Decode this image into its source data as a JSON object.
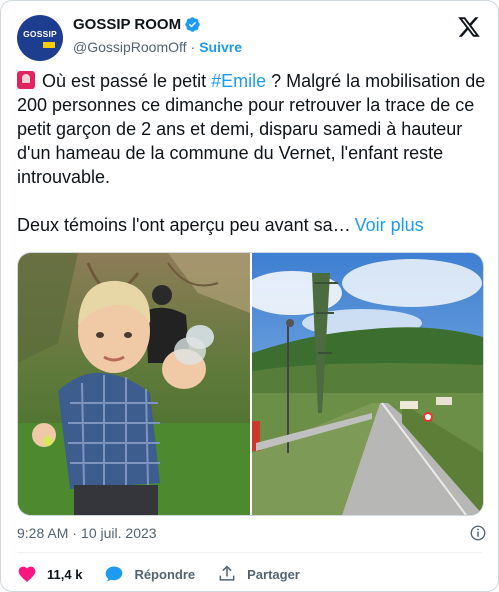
{
  "account": {
    "name": "GOSSIP ROOM",
    "handle": "@GossipRoomOff",
    "separator": "·",
    "follow_label": "Suivre",
    "avatar_text": "GOSSIP"
  },
  "tweet": {
    "text_part1": " Où est passé le petit ",
    "hashtag": "#Emile",
    "text_part2": " ? Malgré la mobilisation de 200 personnes ce dimanche pour retrouver la trace de ce petit garçon de 2 ans et demi, disparu samedi à hauteur d'un hameau de la commune du Vernet, l'enfant reste introuvable.\n\nDeux témoins l'ont aperçu peu avant sa…",
    "see_more": "Voir plus"
  },
  "meta": {
    "time": "9:28 AM",
    "separator": "·",
    "date": "10 juil. 2023"
  },
  "actions": {
    "likes": "11,4 k",
    "reply_label": "Répondre",
    "share_label": "Partager"
  },
  "colors": {
    "accent": "#1d9bf0",
    "like": "#f91880",
    "text": "#0f1419",
    "secondary": "#536471"
  },
  "icons": {
    "verified": "verified-badge-icon",
    "logo": "x-logo-icon",
    "siren": "rotating-light-emoji",
    "like": "heart-icon",
    "reply": "speech-bubble-icon",
    "share": "share-upload-icon",
    "info": "info-icon"
  }
}
